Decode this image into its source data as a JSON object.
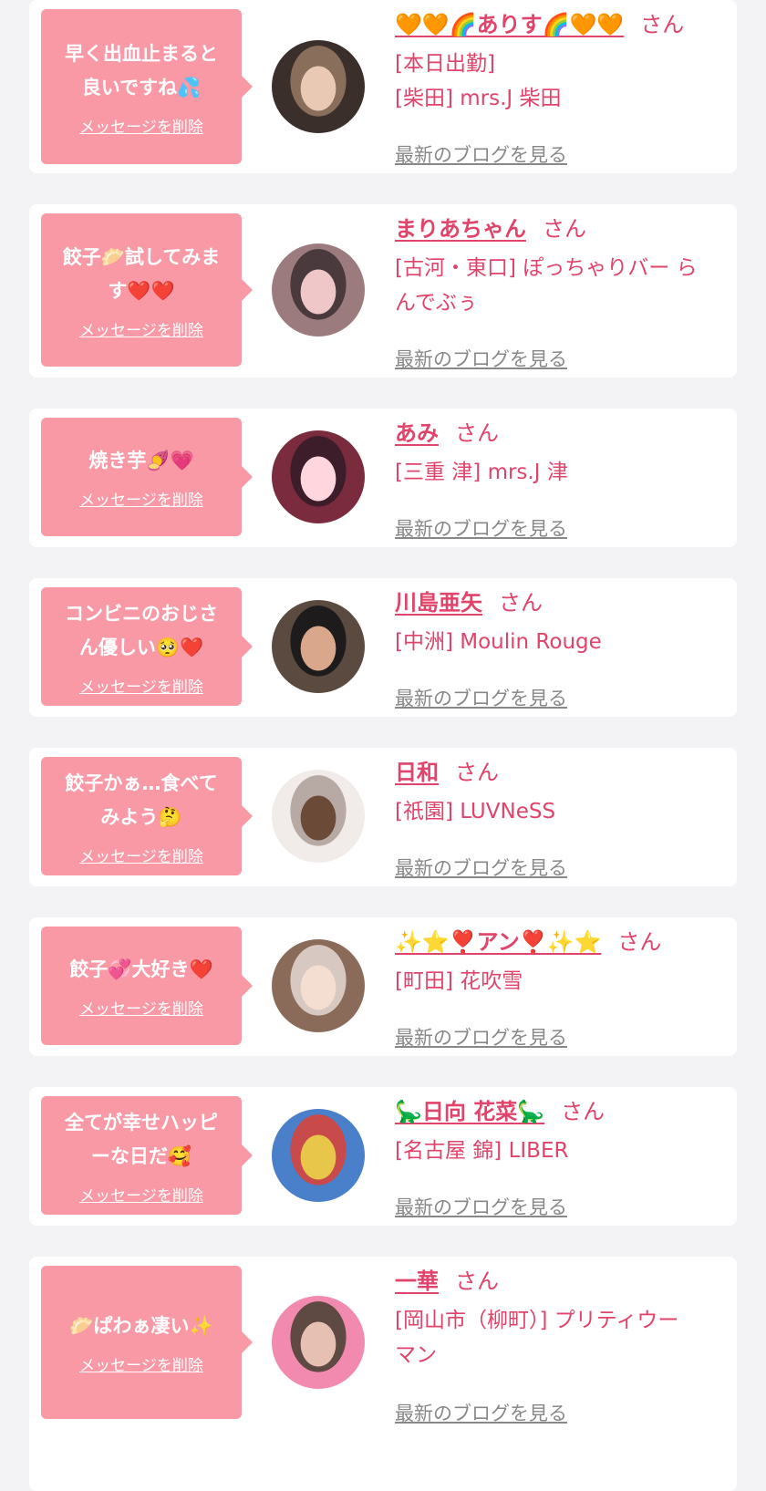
{
  "colors": {
    "bubble": "#f999a6",
    "accent": "#e0446a",
    "muted": "#888888",
    "page_bg": "#f3f3f5",
    "card_bg": "#ffffff"
  },
  "items": [
    {
      "message_lines": [
        "早く出血止まると",
        "良いですね💦"
      ],
      "delete_label": "メッセージを削除",
      "name": "🧡🧡🌈ありす🌈🧡🧡",
      "honorific": "さん",
      "shop_lines": [
        "[本日出勤]",
        "[柴田] mrs.J 柴田"
      ],
      "blog_label": "最新のブログを見る",
      "avatar_colors": [
        "#8a6e5c",
        "#e9c9b4",
        "#3b2f2c"
      ]
    },
    {
      "message_lines": [
        "餃子🥟試してみま",
        "す❤️❤️"
      ],
      "delete_label": "メッセージを削除",
      "name": "まりあちゃん",
      "honorific": "さん",
      "shop_lines": [
        "[古河・東口] ぽっちゃりバー ら",
        "んでぶぅ"
      ],
      "blog_label": "最新のブログを見る",
      "avatar_colors": [
        "#4a3a3e",
        "#f0c7c9",
        "#9c7b7e"
      ]
    },
    {
      "message_lines": [
        "焼き芋🍠💗"
      ],
      "delete_label": "メッセージを削除",
      "name": "あみ",
      "honorific": "さん",
      "shop_lines": [
        "[三重 津] mrs.J 津"
      ],
      "blog_label": "最新のブログを見る",
      "avatar_colors": [
        "#3d1d2a",
        "#ffd6de",
        "#7a2c3e"
      ]
    },
    {
      "message_lines": [
        "コンビニのおじさ",
        "ん優しい🥺❤️"
      ],
      "delete_label": "メッセージを削除",
      "name": "川島亜矢",
      "honorific": "さん",
      "shop_lines": [
        "[中洲] Moulin Rouge"
      ],
      "blog_label": "最新のブログを見る",
      "avatar_colors": [
        "#1e1b1d",
        "#d9a78b",
        "#5b4a3f"
      ]
    },
    {
      "message_lines": [
        "餃子かぁ…食べて",
        "みよう🤔"
      ],
      "delete_label": "メッセージを削除",
      "name": "日和",
      "honorific": "さん",
      "shop_lines": [
        "[祇園] LUVNeSS"
      ],
      "blog_label": "最新のブログを見る",
      "avatar_colors": [
        "#b7a9a3",
        "#6b4a38",
        "#f1ece9"
      ]
    },
    {
      "message_lines": [
        "餃子💞大好き❤️"
      ],
      "delete_label": "メッセージを削除",
      "name": "✨⭐❣️アン❣️✨⭐",
      "honorific": "さん",
      "shop_lines": [
        "[町田] 花吹雪"
      ],
      "blog_label": "最新のブログを見る",
      "avatar_colors": [
        "#d7c8c2",
        "#f4ddd1",
        "#8a6b5a"
      ]
    },
    {
      "message_lines": [
        "全てが幸せハッピ",
        "ーな日だ🥰"
      ],
      "delete_label": "メッセージを削除",
      "name": "🦕日向 花菜🦕",
      "honorific": "さん",
      "shop_lines": [
        "[名古屋 錦] LIBER"
      ],
      "blog_label": "最新のブログを見る",
      "avatar_colors": [
        "#c94a4a",
        "#e8c64a",
        "#4a7fc9"
      ]
    },
    {
      "message_lines": [
        "🥟ぱわぁ凄い✨"
      ],
      "delete_label": "メッセージを削除",
      "name": "一華",
      "honorific": "さん",
      "shop_lines": [
        "[岡山市（柳町）] プリティウー",
        "マン"
      ],
      "blog_label": "最新のブログを見る",
      "avatar_colors": [
        "#5e4a42",
        "#e7c0b4",
        "#f28ab0"
      ]
    }
  ]
}
